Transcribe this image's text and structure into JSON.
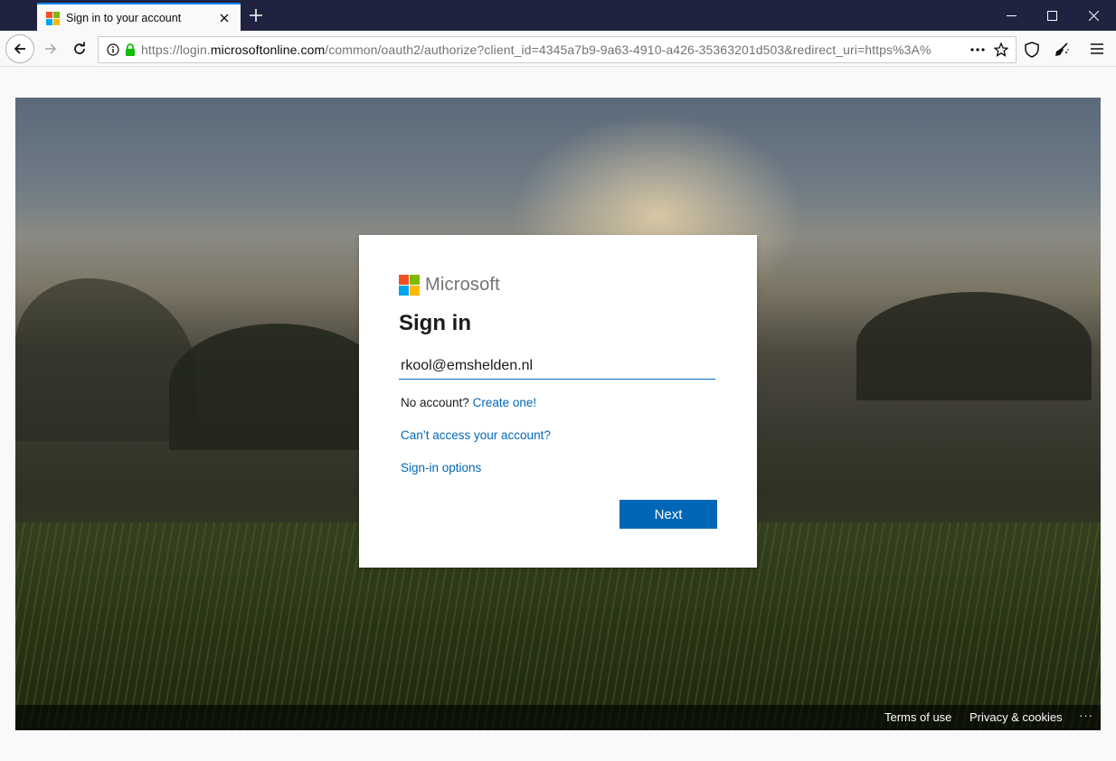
{
  "browser": {
    "tab_title": "Sign in to your account",
    "url_prefix": "https://login.",
    "url_domain": "microsoftonline.com",
    "url_rest": "/common/oauth2/authorize?client_id=4345a7b9-9a63-4910-a426-35363201d503&redirect_uri=https%3A%",
    "icons": [
      "back-icon",
      "forward-icon",
      "reload-icon",
      "info-icon",
      "lock-icon",
      "more-icon",
      "bookmark-star-icon",
      "shield-icon",
      "broom-icon",
      "menu-icon",
      "minimize-icon",
      "maximize-icon",
      "close-icon",
      "new-tab-icon"
    ]
  },
  "signin": {
    "brand": "Microsoft",
    "title": "Sign in",
    "email_value": "rkool@emshelden.nl",
    "no_account_text": "No account?",
    "create_link": "Create one!",
    "cant_access_link": "Can’t access your account?",
    "signin_options_link": "Sign-in options",
    "next_button": "Next"
  },
  "footer": {
    "terms": "Terms of use",
    "privacy": "Privacy & cookies",
    "more": "···"
  },
  "colors": {
    "accent": "#0067b8",
    "ms_red": "#f25022",
    "ms_green": "#7fba00",
    "ms_blue": "#00a4ef",
    "ms_yellow": "#ffb900"
  }
}
